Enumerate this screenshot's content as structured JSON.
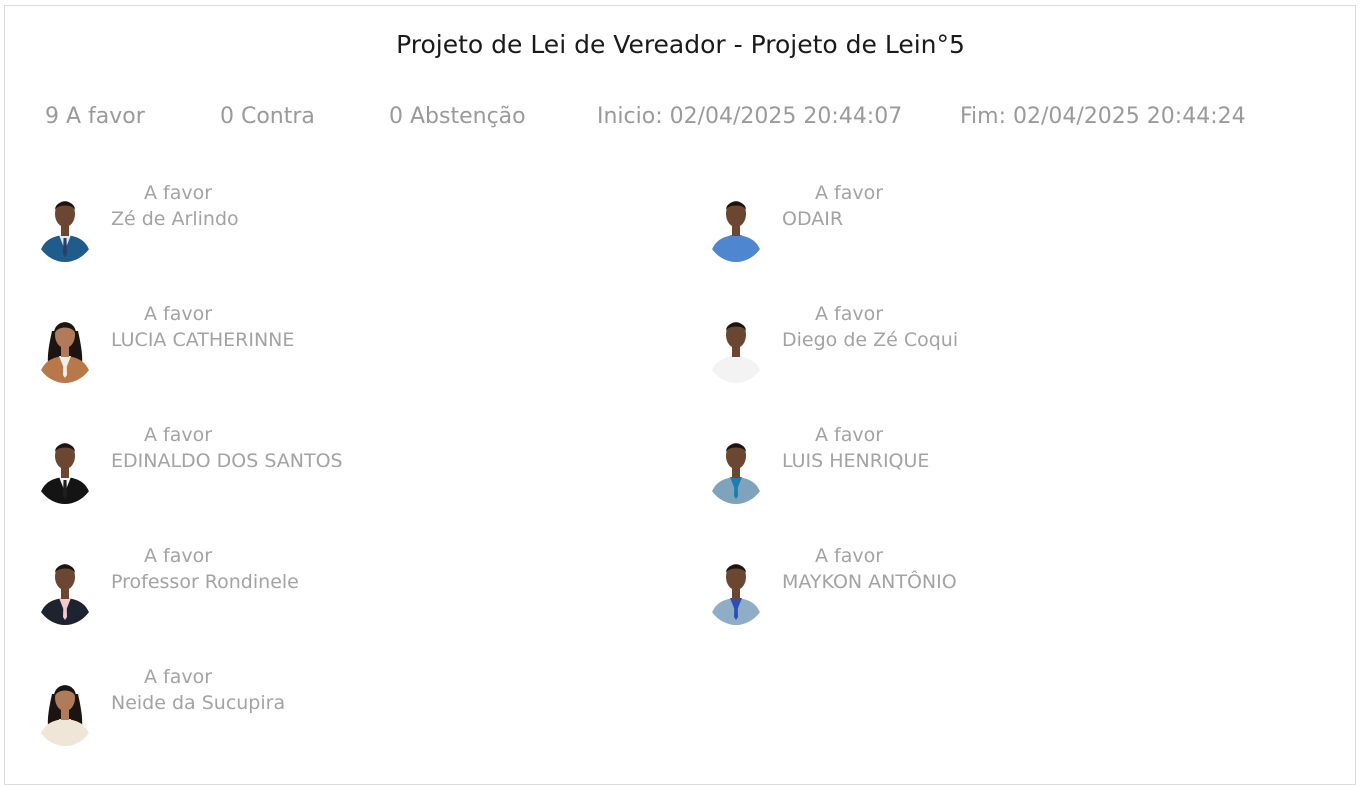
{
  "title": "Projeto de Lei de Vereador - Projeto de Lein°5",
  "summary": {
    "favor": "9 A favor",
    "contra": "0 Contra",
    "abstencao": "0 Abstenção",
    "inicio": "Inicio: 02/04/2025 20:44:07",
    "fim": "Fim: 02/04/2025 20:44:24"
  },
  "voters": [
    {
      "name": "Zé de Arlindo",
      "vote": "A favor",
      "suit": "#1f5c8c",
      "shirt": "#dfe9f4",
      "tie": "#2a3f66"
    },
    {
      "name": "ODAIR",
      "vote": "A favor",
      "suit": "#4f86d0",
      "shirt": "#4f86d0",
      "tie": "#4f86d0"
    },
    {
      "name": "LUCIA CATHERINNE",
      "vote": "A favor",
      "suit": "#b9784a",
      "shirt": "#f2efe9",
      "tie": "#f2efe9"
    },
    {
      "name": "Diego de Zé Coqui",
      "vote": "A favor",
      "suit": "#f3f3f3",
      "shirt": "#f3f3f3",
      "tie": "#f3f3f3"
    },
    {
      "name": "EDINALDO DOS SANTOS",
      "vote": "A favor",
      "suit": "#141414",
      "shirt": "#f4f4f4",
      "tie": "#1e1e1e"
    },
    {
      "name": "LUIS HENRIQUE",
      "vote": "A favor",
      "suit": "#7fa2bd",
      "shirt": "#1a7fb0",
      "tie": "#1a7fb0"
    },
    {
      "name": "Professor Rondinele",
      "vote": "A favor",
      "suit": "#1d2430",
      "shirt": "#f1c9cf",
      "tie": "#f1c9cf"
    },
    {
      "name": "MAYKON ANTÔNIO",
      "vote": "A favor",
      "suit": "#8fadc4",
      "shirt": "#2a4fb5",
      "tie": "#2a4fb5"
    },
    {
      "name": "Neide da Sucupira",
      "vote": "A favor",
      "suit": "#efe6d8",
      "shirt": "#efe6d8",
      "tie": "#efe6d8"
    }
  ],
  "colors": {
    "skin_dark": "#6b4630",
    "skin_light": "#b07b5a",
    "hair": "#1b1410"
  }
}
